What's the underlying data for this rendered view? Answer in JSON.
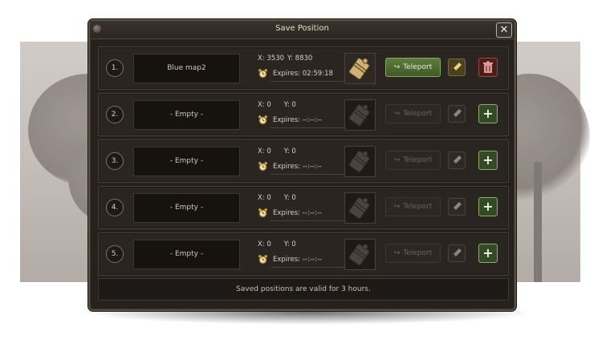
{
  "window": {
    "title": "Save Position",
    "close_glyph": "✕",
    "footer_text": "Saved positions are valid for 3 hours."
  },
  "labels": {
    "teleport": "Teleport",
    "expires_prefix": "Expires:"
  },
  "slots": [
    {
      "number": "1.",
      "name": "Blue map2",
      "x": "X: 3530",
      "y": "Y: 8830",
      "expires": "02:59:18",
      "filled": true,
      "action_icon": "trash-icon"
    },
    {
      "number": "2.",
      "name": "- Empty -",
      "x": "X: 0",
      "y": "Y: 0",
      "expires": "--:--:--",
      "filled": false,
      "action_icon": "plus-icon"
    },
    {
      "number": "3.",
      "name": "- Empty -",
      "x": "X: 0",
      "y": "Y: 0",
      "expires": "--:--:--",
      "filled": false,
      "action_icon": "plus-icon"
    },
    {
      "number": "4.",
      "name": "- Empty -",
      "x": "X: 0",
      "y": "Y: 0",
      "expires": "--:--:--",
      "filled": false,
      "action_icon": "plus-icon"
    },
    {
      "number": "5.",
      "name": "- Empty -",
      "x": "X: 0",
      "y": "Y: 0",
      "expires": "--:--:--",
      "filled": false,
      "action_icon": "plus-icon"
    }
  ],
  "colors": {
    "panel_bg": "#25211c",
    "teleport_active": "#4f6b33",
    "add_button": "#344a26",
    "delete_button": "#4b1e1c"
  }
}
